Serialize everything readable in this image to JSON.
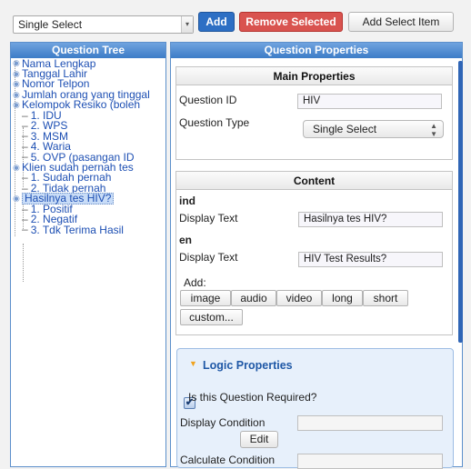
{
  "toolbar": {
    "select_value": "Single Select",
    "add_label": "Add",
    "remove_label": "Remove Selected",
    "add_item_label": "Add Select Item"
  },
  "tree_panel": {
    "title": "Question Tree",
    "items": [
      {
        "label": "Nama Lengkap",
        "level": 0
      },
      {
        "label": "Tanggal Lahir",
        "level": 0
      },
      {
        "label": "Nomor Telpon",
        "level": 0
      },
      {
        "label": "Jumlah orang yang tinggal",
        "level": 0
      },
      {
        "label": "Kelompok Resiko (boleh",
        "level": 0
      },
      {
        "label": "1. IDU",
        "level": 1
      },
      {
        "label": "2. WPS",
        "level": 1
      },
      {
        "label": "3. MSM",
        "level": 1
      },
      {
        "label": "4. Waria",
        "level": 1
      },
      {
        "label": "5. OVP (pasangan ID",
        "level": 1
      },
      {
        "label": "Klien sudah pernah tes",
        "level": 0
      },
      {
        "label": "1. Sudah pernah",
        "level": 1
      },
      {
        "label": "2. Tidak pernah",
        "level": 1
      },
      {
        "label": "Hasilnya tes HIV?",
        "level": 0,
        "selected": true
      },
      {
        "label": "1. Positif",
        "level": 1
      },
      {
        "label": "2. Negatif",
        "level": 1
      },
      {
        "label": "3. Tdk Terima Hasil",
        "level": 1
      }
    ]
  },
  "props_panel": {
    "title": "Question Properties",
    "main": {
      "title": "Main Properties",
      "id_label": "Question ID",
      "id_value": "HIV",
      "type_label": "Question Type",
      "type_value": "Single Select"
    },
    "content": {
      "title": "Content",
      "lang1": "ind",
      "display_label_1": "Display Text",
      "display_value_1": "Hasilnya tes HIV?",
      "lang2": "en",
      "display_label_2": "Display Text",
      "display_value_2": "HIV Test Results?",
      "add_label": "Add:",
      "media_buttons": [
        "image",
        "audio",
        "video",
        "long",
        "short"
      ],
      "custom_label": "custom..."
    },
    "logic": {
      "title": "Logic Properties",
      "required_label": "Is this Question Required?",
      "required_checked": true,
      "display_condition_label": "Display Condition",
      "display_condition_value": "",
      "edit_label": "Edit",
      "calculate_condition_label": "Calculate Condition",
      "calculate_condition_value": ""
    }
  },
  "colors": {
    "accent_blue": "#2d6fc4",
    "danger_red": "#d9534f",
    "header_blue": "#3c7cc7",
    "tree_text": "#1d4fb3"
  }
}
